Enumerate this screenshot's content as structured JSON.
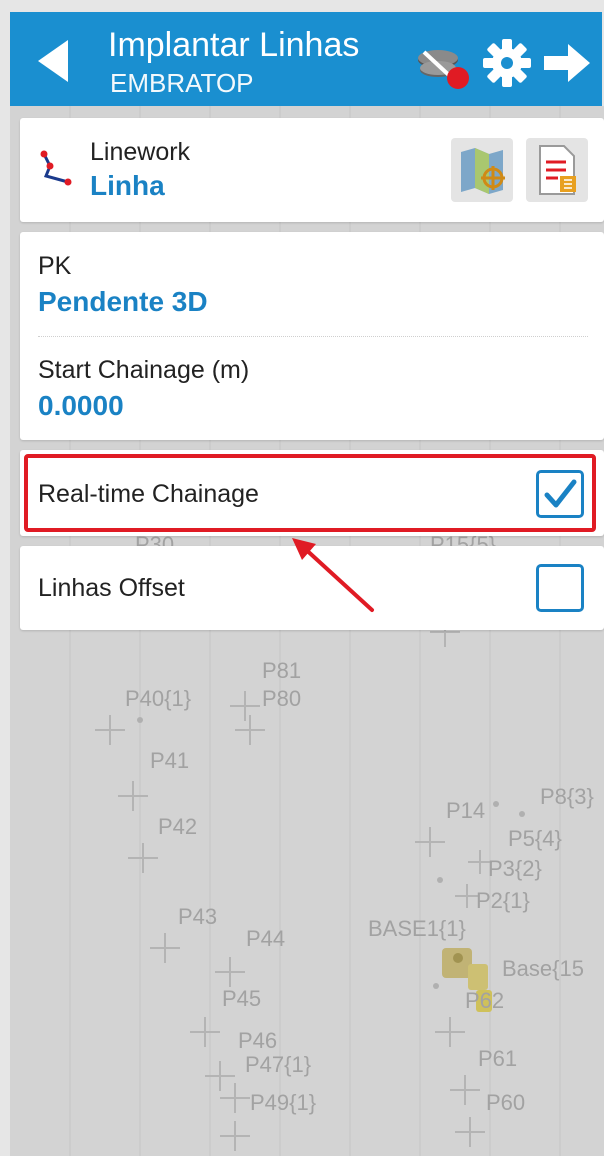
{
  "header": {
    "title": "Implantar Linhas",
    "subtitle": "EMBRATOP"
  },
  "linework": {
    "label": "Linework",
    "value": "Linha"
  },
  "pk": {
    "label": "PK",
    "value": "Pendente 3D"
  },
  "start_chainage": {
    "label": "Start Chainage (m)",
    "value": "0.0000"
  },
  "realtime_chainage": {
    "label": "Real-time Chainage",
    "checked": true
  },
  "linhas_offset": {
    "label": "Linhas Offset",
    "checked": false
  },
  "map_points": [
    {
      "label": "P30"
    },
    {
      "label": "P15{5}"
    },
    {
      "label": "P81"
    },
    {
      "label": "P80"
    },
    {
      "label": "P40{1}"
    },
    {
      "label": "P41"
    },
    {
      "label": "P42"
    },
    {
      "label": "P14"
    },
    {
      "label": "P8{3}"
    },
    {
      "label": "P5{4}"
    },
    {
      "label": "P3{2}"
    },
    {
      "label": "P2{1}"
    },
    {
      "label": "P43"
    },
    {
      "label": "P44"
    },
    {
      "label": "BASE1{1}"
    },
    {
      "label": "Base{15"
    },
    {
      "label": "P45"
    },
    {
      "label": "P62"
    },
    {
      "label": "P46"
    },
    {
      "label": "P47{1}"
    },
    {
      "label": "P61"
    },
    {
      "label": "P49{1}"
    },
    {
      "label": "P60"
    }
  ],
  "colors": {
    "accent": "#1a8fd0",
    "value_blue": "#1a82c4",
    "highlight_red": "#e01b24"
  }
}
